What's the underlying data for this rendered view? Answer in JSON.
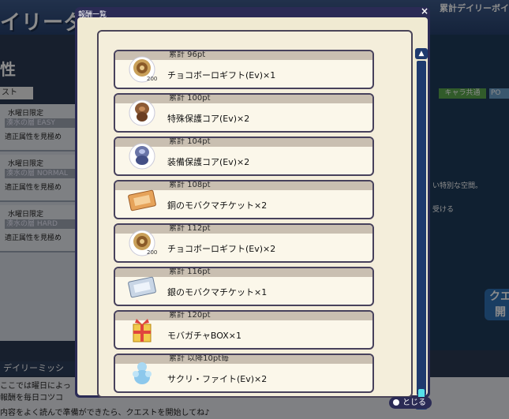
{
  "background": {
    "title": "イリーダ",
    "right_title": "累計デイリーボイ",
    "attribute_label": "性",
    "tab_label": "スト",
    "chips": [
      "キャラ共通",
      "PO"
    ],
    "quest_rows": [
      {
        "day": "水曜日限定",
        "stage": "湊水の層 EASY",
        "hint": "適正属性を見極め"
      },
      {
        "day": "水曜日限定",
        "stage": "湊水の層 NORMAL",
        "hint": "適正属性を見極め"
      },
      {
        "day": "水曜日限定",
        "stage": "湊水の層 HARD",
        "hint": "適正属性を見極め"
      }
    ],
    "right_texts": [
      "い特別な空間。",
      "受ける"
    ],
    "quest_button": "クエ 開",
    "daily_label": "デイリーミッシ",
    "bottom_lines": [
      "ここでは曜日によっ",
      "報酬を毎日コツコ",
      "内容をよく読んで準備ができたら、クエストを開始してね♪"
    ]
  },
  "dialog": {
    "title": "報酬一覧",
    "close_icon": "×",
    "close_button_label": "とじる",
    "rewards": [
      {
        "points": "累計 96pt",
        "name": "チョコボーロギフト(Ev)×1",
        "icon": "choco-gift-icon",
        "badge": "200"
      },
      {
        "points": "累計 100pt",
        "name": "特殊保護コア(Ev)×2",
        "icon": "special-core-icon",
        "badge": ""
      },
      {
        "points": "累計 104pt",
        "name": "装備保護コア(Ev)×2",
        "icon": "equip-core-icon",
        "badge": ""
      },
      {
        "points": "累計 108pt",
        "name": "銅のモバクマチケット×2",
        "icon": "bronze-ticket-icon",
        "badge": ""
      },
      {
        "points": "累計 112pt",
        "name": "チョコボーロギフト(Ev)×2",
        "icon": "choco-gift-icon",
        "badge": "200"
      },
      {
        "points": "累計 116pt",
        "name": "銀のモバクマチケット×1",
        "icon": "silver-ticket-icon",
        "badge": ""
      },
      {
        "points": "累計 120pt",
        "name": "モバガチャBOX×1",
        "icon": "gacha-box-icon",
        "badge": ""
      },
      {
        "points": "累計 以降10pt毎",
        "name": "サクリ・ファイト(Ev)×2",
        "icon": "sacri-fight-icon",
        "badge": ""
      }
    ]
  },
  "colors": {
    "frame": "#2b2b55",
    "panel": "#f0ead2",
    "band": "#c9bfb1",
    "scroll": "#1f3a6e",
    "thumb": "#55e0e8"
  }
}
